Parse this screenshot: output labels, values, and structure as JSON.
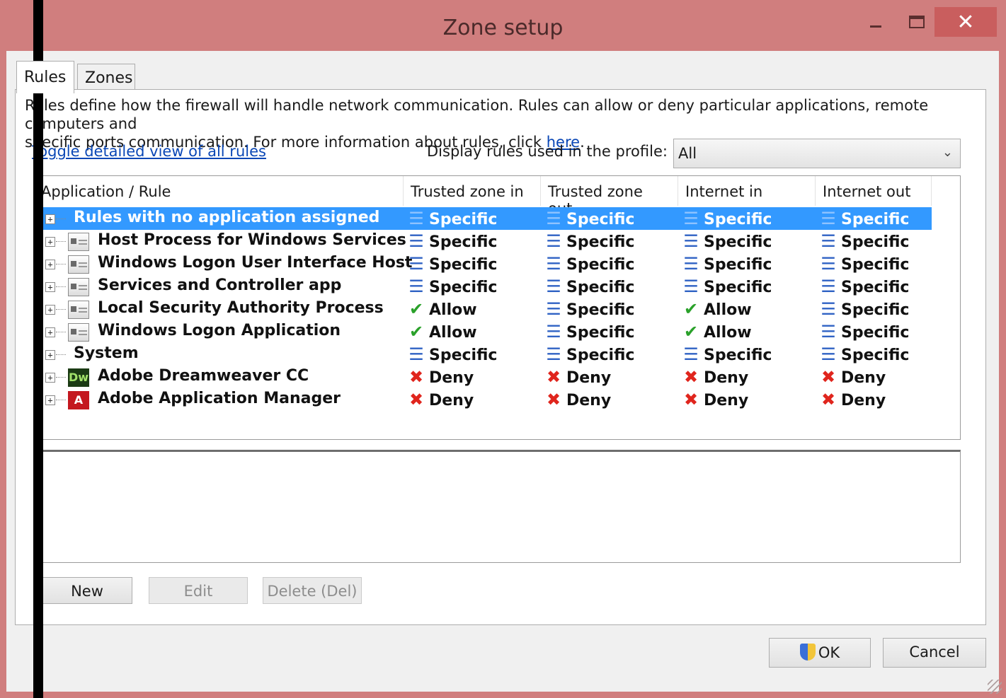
{
  "window": {
    "title": "Zone setup",
    "close_glyph": "✕"
  },
  "tabs": [
    {
      "label": "Rules"
    },
    {
      "label": "Zones"
    }
  ],
  "description": {
    "line1": "Rules define how the firewall will handle network communication. Rules can allow or deny particular applications, remote computers and",
    "line2": "specific ports communication. For more information about rules, click",
    "link": "here",
    "tail": "."
  },
  "toggle_link": "Toggle detailed view of all rules",
  "profile": {
    "label": "Display rules used in the profile:",
    "value": "All"
  },
  "columns": [
    "Application / Rule",
    "Trusted zone in",
    "Trusted zone out",
    "Internet in",
    "Internet out"
  ],
  "rows": [
    {
      "name": "Rules with no application assigned",
      "icon": "none",
      "selected": true,
      "values": [
        "Specific",
        "Specific",
        "Specific",
        "Specific"
      ]
    },
    {
      "name": "Host Process for Windows Services",
      "icon": "window-icon",
      "selected": false,
      "values": [
        "Specific",
        "Specific",
        "Specific",
        "Specific"
      ]
    },
    {
      "name": "Windows Logon User Interface Host",
      "icon": "window-icon",
      "selected": false,
      "values": [
        "Specific",
        "Specific",
        "Specific",
        "Specific"
      ]
    },
    {
      "name": "Services and Controller app",
      "icon": "window-icon",
      "selected": false,
      "values": [
        "Specific",
        "Specific",
        "Specific",
        "Specific"
      ]
    },
    {
      "name": "Local Security Authority Process",
      "icon": "window-icon",
      "selected": false,
      "values": [
        "Allow",
        "Specific",
        "Allow",
        "Specific"
      ]
    },
    {
      "name": "Windows Logon Application",
      "icon": "window-icon",
      "selected": false,
      "values": [
        "Allow",
        "Specific",
        "Allow",
        "Specific"
      ]
    },
    {
      "name": "System",
      "icon": "none",
      "selected": false,
      "values": [
        "Specific",
        "Specific",
        "Specific",
        "Specific"
      ]
    },
    {
      "name": "Adobe Dreamweaver CC",
      "icon": "dreamweaver-icon",
      "icon_text": "Dw",
      "selected": false,
      "values": [
        "Deny",
        "Deny",
        "Deny",
        "Deny"
      ]
    },
    {
      "name": "Adobe Application Manager",
      "icon": "adobe-icon",
      "icon_text": "A",
      "selected": false,
      "values": [
        "Deny",
        "Deny",
        "Deny",
        "Deny"
      ]
    }
  ],
  "buttons": {
    "new": "New",
    "edit": "Edit",
    "delete": "Delete (Del)",
    "ok": "OK",
    "cancel": "Cancel"
  },
  "colors": {
    "title_bar": "#d07e7e",
    "close_button": "#c95e5e",
    "selection": "#3399ff",
    "specific": "#2f62c4",
    "allow": "#2aa12a",
    "deny": "#e0251d",
    "link": "#0a47b6"
  }
}
